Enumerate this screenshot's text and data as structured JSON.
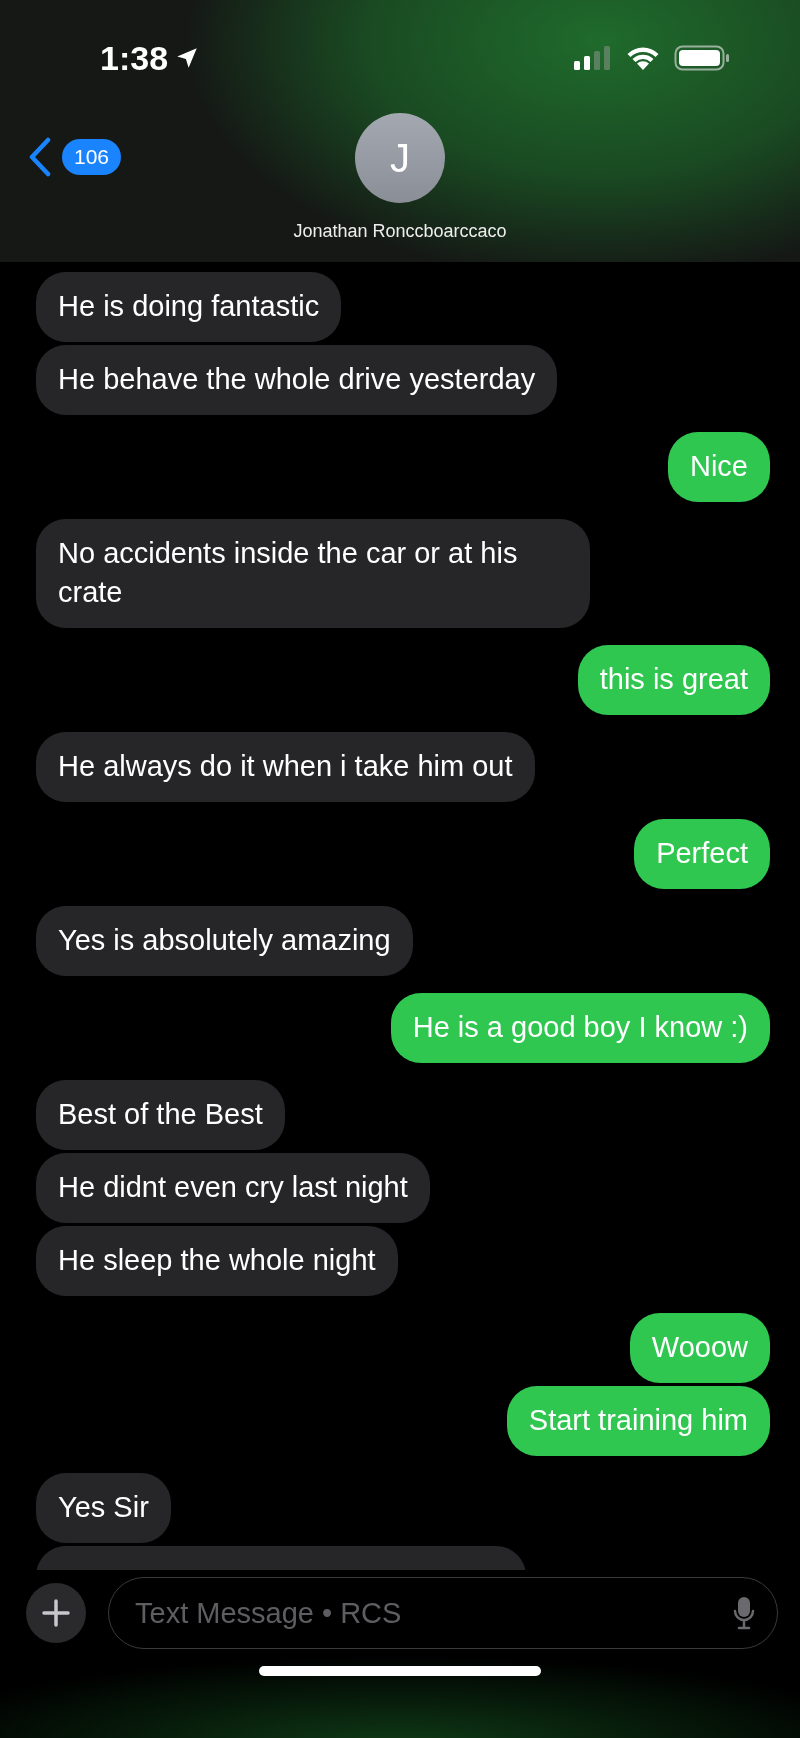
{
  "status_bar": {
    "time": "1:38"
  },
  "header": {
    "back_count": "106",
    "avatar_initial": "J",
    "contact_name": "Jonathan Ronccboarccaco"
  },
  "messages": [
    {
      "kind": "received",
      "text": "He is doing fantastic"
    },
    {
      "kind": "received",
      "text": "He behave the whole drive yesterday"
    },
    {
      "kind": "sent",
      "text": "Nice"
    },
    {
      "kind": "received",
      "text": "No accidents inside the car or at his crate"
    },
    {
      "kind": "sent",
      "text": "this is great"
    },
    {
      "kind": "received",
      "text": "He always do it when i take him out"
    },
    {
      "kind": "sent",
      "text": "Perfect"
    },
    {
      "kind": "received",
      "text": "Yes is absolutely amazing"
    },
    {
      "kind": "sent",
      "text": "He is a good boy I know :)"
    },
    {
      "kind": "received",
      "text": "Best of the Best"
    },
    {
      "kind": "received",
      "text": "He didnt even cry last night"
    },
    {
      "kind": "received",
      "text": "He sleep the whole night"
    },
    {
      "kind": "sent",
      "text": "Wooow"
    },
    {
      "kind": "sent",
      "text": "Start training him"
    },
    {
      "kind": "received",
      "text": "Yes Sir"
    }
  ],
  "composer": {
    "placeholder": "Text Message • RCS"
  }
}
